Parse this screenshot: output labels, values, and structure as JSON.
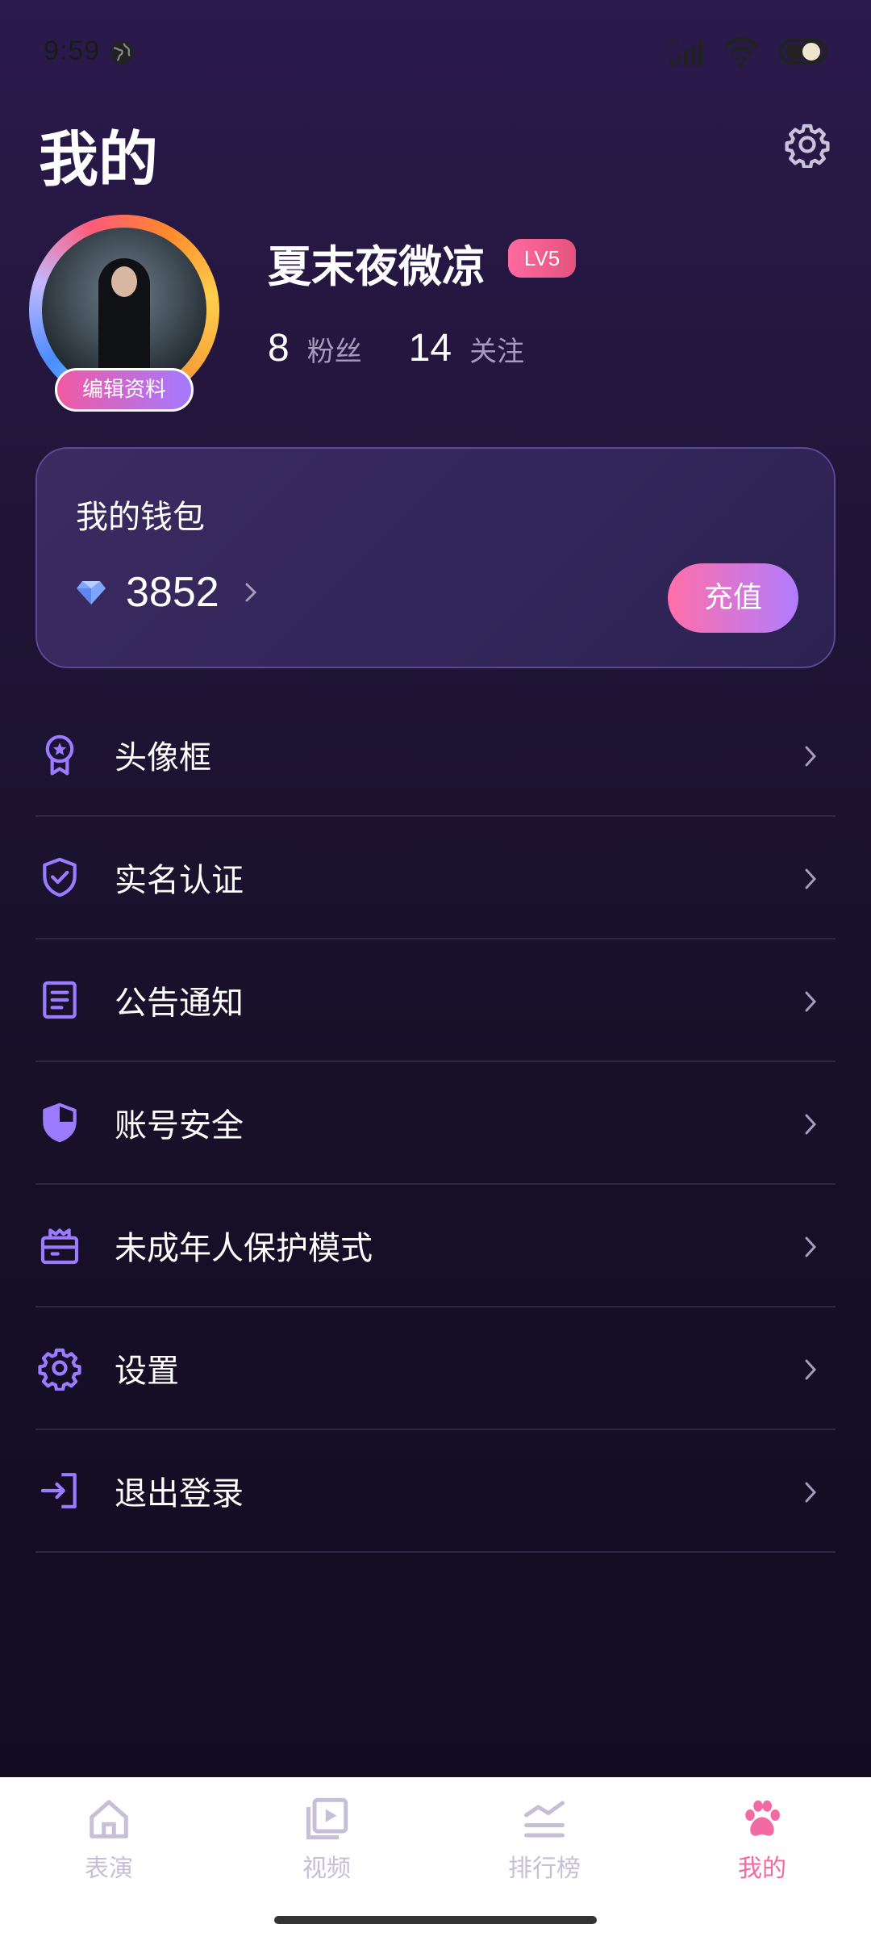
{
  "status_bar": {
    "time": "9:59",
    "icons": [
      "globe-icon",
      "hd-signal-icon",
      "wifi-icon",
      "battery-icon"
    ]
  },
  "header": {
    "title": "我的",
    "settings_icon": "gear-icon"
  },
  "profile": {
    "username": "夏末夜微凉",
    "level": "LV5",
    "edit_label": "编辑资料",
    "fans_count": "8",
    "fans_label": "粉丝",
    "following_count": "14",
    "following_label": "关注"
  },
  "wallet": {
    "title": "我的钱包",
    "balance": "3852",
    "recharge_label": "充值"
  },
  "menu": {
    "items": [
      {
        "label": "头像框",
        "icon": "badge-icon"
      },
      {
        "label": "实名认证",
        "icon": "shield-check-icon"
      },
      {
        "label": "公告通知",
        "icon": "document-icon"
      },
      {
        "label": "账号安全",
        "icon": "shield-half-icon"
      },
      {
        "label": "未成年人保护模式",
        "icon": "gift-box-icon"
      },
      {
        "label": "设置",
        "icon": "gear-icon"
      },
      {
        "label": "退出登录",
        "icon": "logout-icon"
      }
    ]
  },
  "bottom_nav": {
    "items": [
      {
        "label": "表演",
        "icon": "home-icon",
        "active": false
      },
      {
        "label": "视频",
        "icon": "video-icon",
        "active": false
      },
      {
        "label": "排行榜",
        "icon": "chart-icon",
        "active": false
      },
      {
        "label": "我的",
        "icon": "paw-icon",
        "active": true
      }
    ]
  },
  "colors": {
    "accent_purple": "#9b7bff",
    "accent_pink": "#f26aa4",
    "background_top": "#2b1a4d",
    "background_bottom": "#120a1f"
  }
}
